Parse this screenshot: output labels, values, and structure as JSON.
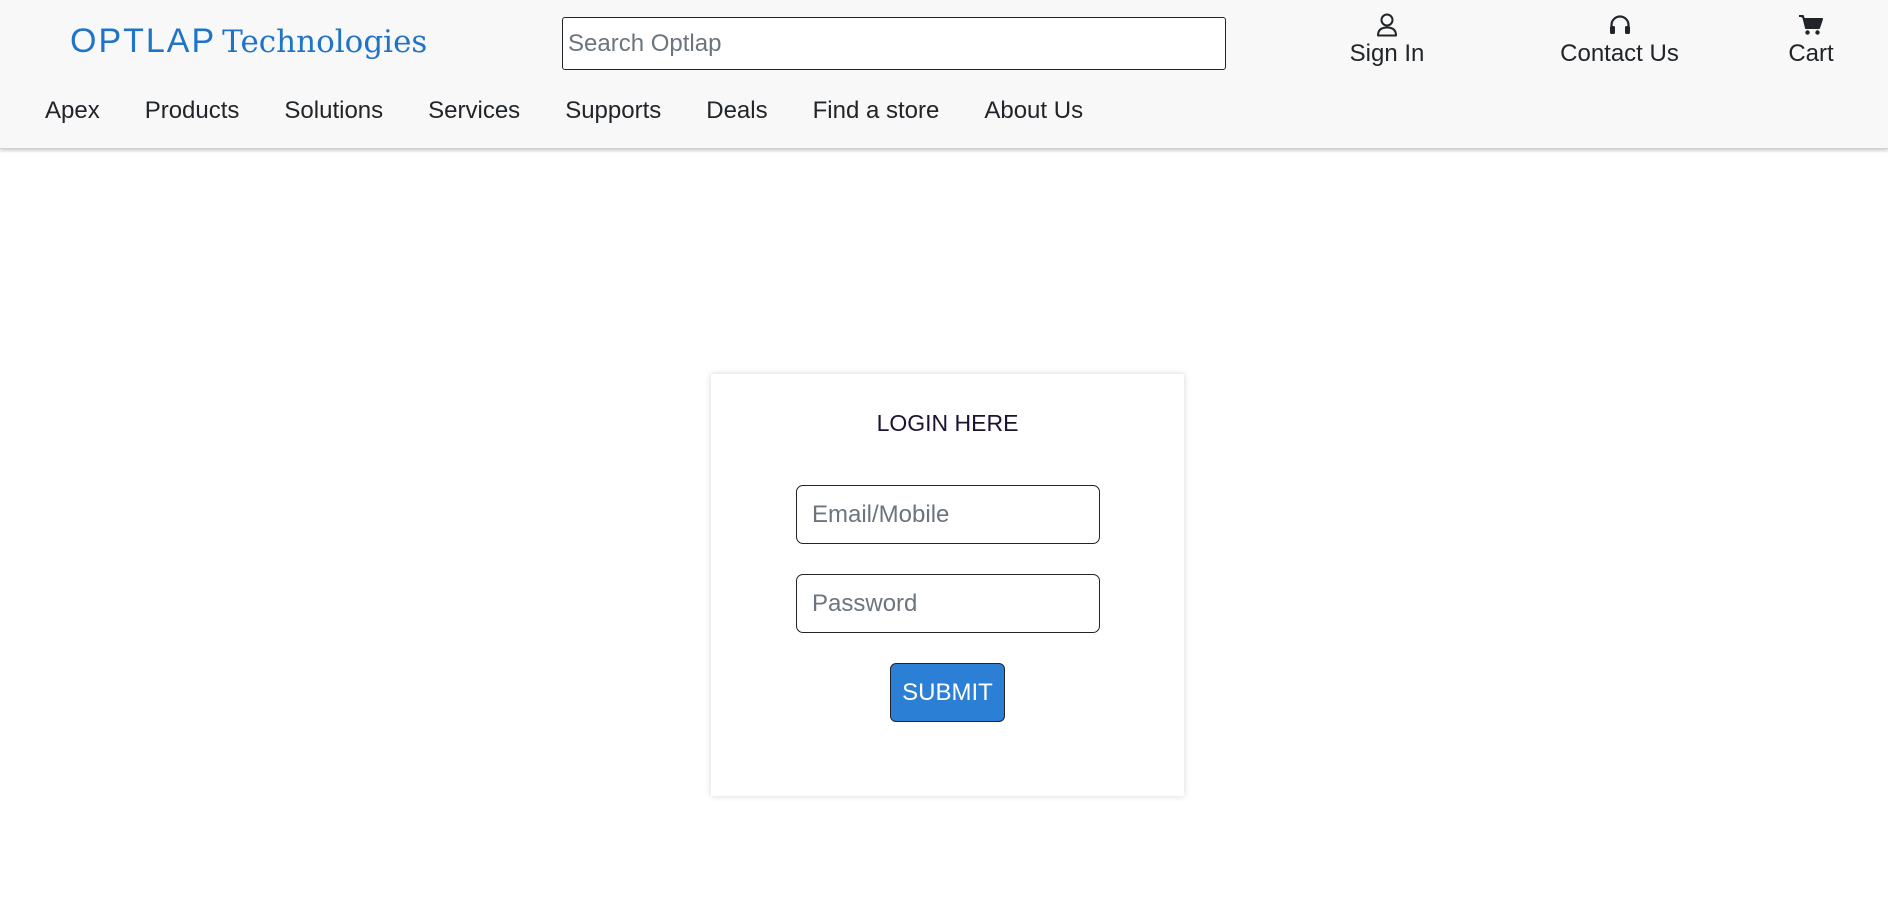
{
  "brand": {
    "mark": "OPTLAP",
    "word": "Technologies",
    "color": "#1f74c7"
  },
  "search": {
    "placeholder": "Search Optlap",
    "value": ""
  },
  "header_actions": [
    {
      "label": "Sign In",
      "icon": "user-icon"
    },
    {
      "label": "Contact Us",
      "icon": "headphones-icon"
    },
    {
      "label": "Cart",
      "icon": "cart-icon"
    }
  ],
  "nav": {
    "items": [
      "Apex",
      "Products",
      "Solutions",
      "Services",
      "Supports",
      "Deals",
      "Find a store",
      "About Us"
    ]
  },
  "login": {
    "title": "LOGIN HERE",
    "email_placeholder": "Email/Mobile",
    "email_value": "",
    "password_placeholder": "Password",
    "password_value": "",
    "submit_label": "SUBMIT",
    "submit_color": "#2b7fd4"
  }
}
